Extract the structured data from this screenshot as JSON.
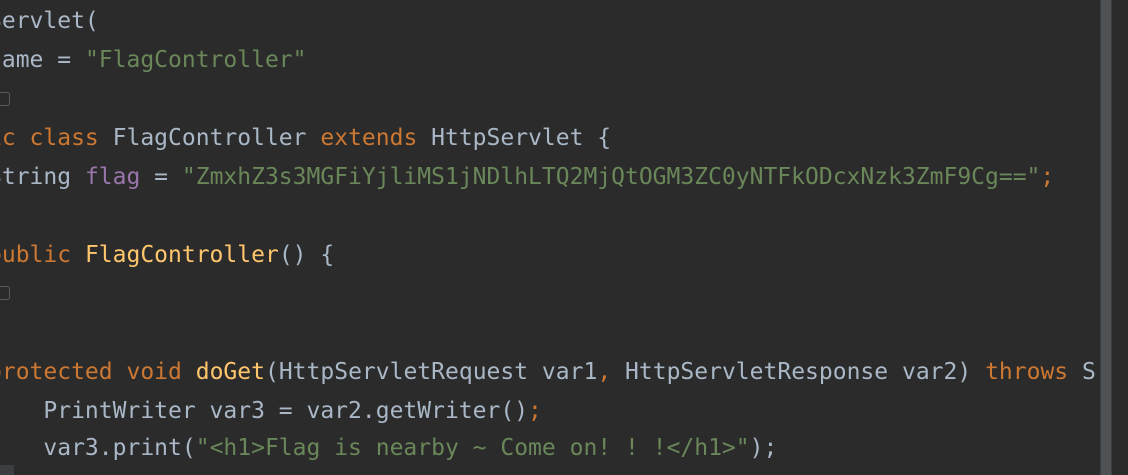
{
  "editor": {
    "lines": [
      {
        "tokens": [
          {
            "t": "Servlet(",
            "c": "plain"
          }
        ]
      },
      {
        "tokens": [
          {
            "t": "name",
            "c": "plain"
          },
          {
            "t": " = ",
            "c": "plain"
          },
          {
            "t": "\"FlagController\"",
            "c": "str"
          }
        ]
      },
      {
        "tokens": []
      },
      {
        "tokens": [
          {
            "t": "ic ",
            "c": "kw"
          },
          {
            "t": "class ",
            "c": "kw"
          },
          {
            "t": "FlagController ",
            "c": "plain"
          },
          {
            "t": "extends ",
            "c": "kw"
          },
          {
            "t": "HttpServlet {",
            "c": "plain"
          }
        ]
      },
      {
        "tokens": [
          {
            "t": "String ",
            "c": "plain"
          },
          {
            "t": "flag",
            "c": "fld"
          },
          {
            "t": " = ",
            "c": "plain"
          },
          {
            "t": "\"ZmxhZ3s3MGFiYjliMS1jNDlhLTQ2MjQtOGM3ZC0yNTFkODcxNzk3ZmF9Cg==\"",
            "c": "str"
          },
          {
            "t": ";",
            "c": "kw"
          }
        ]
      },
      {
        "tokens": []
      },
      {
        "tokens": [
          {
            "t": "public ",
            "c": "kw"
          },
          {
            "t": "FlagController",
            "c": "fn"
          },
          {
            "t": "() {",
            "c": "plain"
          }
        ]
      },
      {
        "tokens": [
          {
            "t": "}",
            "c": "plain"
          }
        ]
      },
      {
        "tokens": []
      },
      {
        "tokens": [
          {
            "t": "protected ",
            "c": "kw"
          },
          {
            "t": "void ",
            "c": "kw"
          },
          {
            "t": "doGet",
            "c": "fn"
          },
          {
            "t": "(HttpServletRequest var1",
            "c": "plain"
          },
          {
            "t": ", ",
            "c": "kw"
          },
          {
            "t": "HttpServletResponse var2) ",
            "c": "plain"
          },
          {
            "t": "throws ",
            "c": "kw"
          },
          {
            "t": "S",
            "c": "plain"
          }
        ]
      },
      {
        "tokens": [
          {
            "t": "    PrintWriter var3 = var2.getWriter()",
            "c": "plain"
          },
          {
            "t": ";",
            "c": "kw"
          }
        ]
      },
      {
        "tokens": [
          {
            "t": "    var3.print(",
            "c": "plain"
          },
          {
            "t": "\"<h1>Flag is nearby ~ Come on! ! !</h1>\"",
            "c": "str"
          },
          {
            "t": ");",
            "c": "plain"
          }
        ]
      }
    ]
  },
  "colors": {
    "background": "#2b2b2b",
    "keyword": "#cc7832",
    "string": "#6a8759",
    "field": "#9876aa",
    "function": "#ffc66d",
    "text": "#a9b7c6"
  }
}
